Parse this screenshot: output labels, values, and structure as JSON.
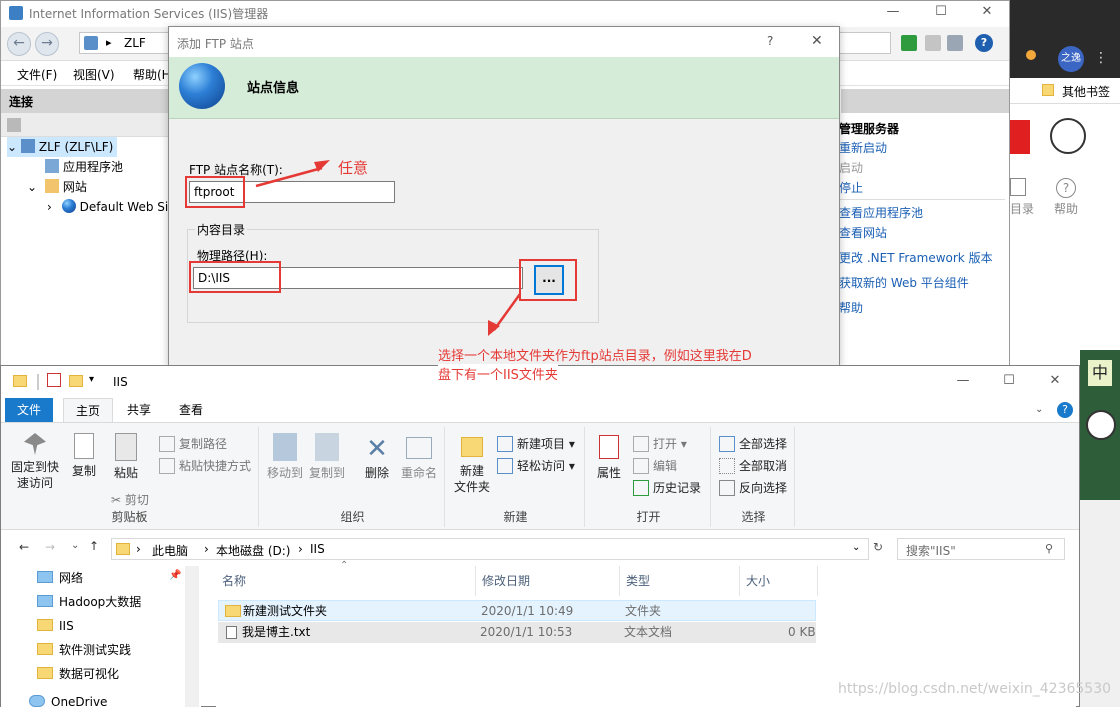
{
  "iis": {
    "title": "Internet Information Services (IIS)管理器",
    "address": [
      "ZLF",
      "▸"
    ],
    "menu": [
      "文件(F)",
      "视图(V)",
      "帮助(H"
    ],
    "connections_title": "连接",
    "tree": [
      {
        "label": "ZLF (ZLF\\LF)",
        "expander": "⌄",
        "selected": true
      },
      {
        "label": "应用程序池",
        "expander": ""
      },
      {
        "label": "网站",
        "expander": "⌄"
      },
      {
        "label": "Default Web Si",
        "expander": "›"
      }
    ],
    "actions": [
      {
        "label": "管理服务器",
        "style": "title"
      },
      {
        "label": "重新启动",
        "style": "link"
      },
      {
        "label": "启动",
        "style": "grey"
      },
      {
        "label": "停止",
        "style": "link"
      },
      {
        "label": "查看应用程序池",
        "style": "link"
      },
      {
        "label": "查看网站",
        "style": "link"
      },
      {
        "label": "更改 .NET Framework 版本",
        "style": "link"
      },
      {
        "label": "获取新的 Web 平台组件",
        "style": "link"
      },
      {
        "label": "帮助",
        "style": "link"
      }
    ],
    "feature_labels": {
      "dir": "目录",
      "help": "帮助"
    }
  },
  "browser": {
    "bookmark": "其他书签",
    "avatar": "之逸",
    "side_text": "中"
  },
  "dialog": {
    "title": "添加 FTP 站点",
    "help": "?",
    "close": "✕",
    "banner": "站点信息",
    "site_name_label": "FTP 站点名称(T):",
    "site_name_value": "ftproot",
    "content_dir": "内容目录",
    "path_label": "物理路径(H):",
    "path_value": "D:\\IIS",
    "browse": "..."
  },
  "annotations": {
    "anno1": "任意",
    "anno2_line1": "选择一个本地文件夹作为ftp站点目录，例如这里我在D",
    "anno2_line2": "盘下有一个IIS文件夹"
  },
  "explorer": {
    "title": "IIS",
    "tabs": [
      "文件",
      "主页",
      "共享",
      "查看"
    ],
    "ribbon": {
      "clipboard": {
        "pin": "固定到快\n速访问",
        "copy": "复制",
        "paste": "粘贴",
        "copy_path": "复制路径",
        "paste_shortcut": "粘贴快捷方式",
        "cut": "剪切",
        "label": "剪贴板"
      },
      "organize": {
        "move": "移动到",
        "copyto": "复制到",
        "delete": "删除",
        "rename": "重命名",
        "label": "组织"
      },
      "new": {
        "folder": "新建\n文件夹",
        "item": "新建项目",
        "easy": "轻松访问",
        "label": "新建"
      },
      "open": {
        "props": "属性",
        "open": "打开",
        "edit": "编辑",
        "history": "历史记录",
        "label": "打开"
      },
      "select": {
        "all": "全部选择",
        "none": "全部取消",
        "invert": "反向选择",
        "label": "选择"
      }
    },
    "breadcrumb": [
      "此电脑",
      "本地磁盘 (D:)",
      "IIS"
    ],
    "search_placeholder": "搜索\"IIS\"",
    "nav": [
      "网络",
      "Hadoop大数据",
      "IIS",
      "软件测试实践",
      "数据可视化",
      "OneDrive"
    ],
    "columns": [
      "名称",
      "修改日期",
      "类型",
      "大小"
    ],
    "files": [
      {
        "name": "新建测试文件夹",
        "date": "2020/1/1 10:49",
        "type": "文件夹",
        "size": ""
      },
      {
        "name": "我是博主.txt",
        "date": "2020/1/1 10:53",
        "type": "文本文档",
        "size": "0 KB"
      }
    ]
  },
  "watermark": "https://blog.csdn.net/weixin_42365530",
  "colors": {
    "accent": "#0078d7",
    "annotation": "#e53935",
    "banner": "#d5ecd8"
  }
}
